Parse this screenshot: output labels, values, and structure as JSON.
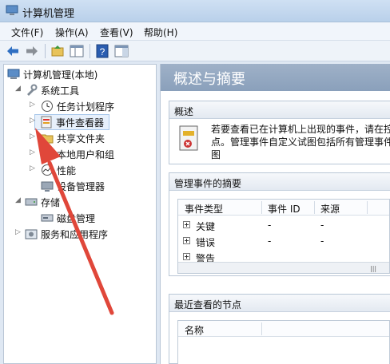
{
  "window": {
    "title": "计算机管理"
  },
  "menu": [
    "文件(F)",
    "操作(A)",
    "查看(V)",
    "帮助(H)"
  ],
  "toolbar": {
    "icons": [
      "back-icon",
      "forward-icon",
      "up-folder-icon",
      "show-hide-tree-icon",
      "help-icon",
      "show-action-pane-icon"
    ]
  },
  "tree": {
    "root": "计算机管理(本地)",
    "system_tools": "系统工具",
    "task_scheduler": "任务计划程序",
    "event_viewer": "事件查看器",
    "shared_folders": "共享文件夹",
    "local_users": "本地用户和组",
    "performance": "性能",
    "device_manager": "设备管理器",
    "storage": "存储",
    "disk_management": "磁盘管理",
    "services_apps": "服务和应用程序"
  },
  "content": {
    "banner_title": "概述与摘要",
    "overview": {
      "header": "概述",
      "text_line1": "若要查看已在计算机上出现的事件，请在控",
      "text_line2": "点。管理事件自定义试图包括所有管理事件",
      "text_line3": "图"
    },
    "summary": {
      "header": "管理事件的摘要",
      "columns": [
        "事件类型",
        "事件 ID",
        "来源"
      ],
      "rows": [
        {
          "type": "关键",
          "id": "-",
          "source": "-"
        },
        {
          "type": "错误",
          "id": "-",
          "source": "-"
        },
        {
          "type": "警告",
          "id": "",
          "source": ""
        }
      ]
    },
    "recent": {
      "header": "最近查看的节点",
      "columns": [
        "名称"
      ]
    }
  },
  "colors": {
    "banner": "#8aa0bb",
    "arrow": "#e0473a",
    "selection": "#e7f0fb"
  }
}
